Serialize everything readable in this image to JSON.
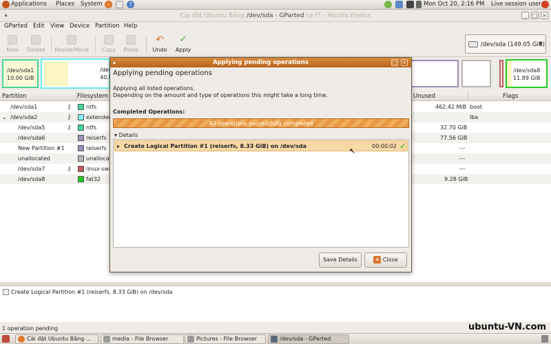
{
  "top_panel": {
    "menus": [
      "Applications",
      "Places",
      "System"
    ],
    "clock": "Mon Oct 20,  2:16 PM",
    "session": "Live session user"
  },
  "window": {
    "title_faded_left": "Cài đặt Ubuntu Bằng",
    "title": "/dev/sda - GParted",
    "title_faded_right": "ce IT - Mozilla Firefox"
  },
  "menubar": [
    "GParted",
    "Edit",
    "View",
    "Device",
    "Partition",
    "Help"
  ],
  "toolbar": {
    "new": "New",
    "delete": "Delete",
    "resize_move": "Resize/Move",
    "copy": "Copy",
    "paste": "Paste",
    "undo": "Undo",
    "apply": "Apply"
  },
  "device_selector": {
    "label": "/dev/sda  (149.05 GiB)"
  },
  "graph": {
    "sda1_name": "/dev/sda1",
    "sda1_size": "10.00 GiB",
    "sda2_name": "/dev/",
    "sda2_size": "40.0",
    "sda8_name": "/dev/sda8",
    "sda8_size": "11.89 GiB"
  },
  "table": {
    "headers": {
      "partition": "Partition",
      "filesystem": "Filesystem",
      "unused": "Unused",
      "flags": "Flags"
    },
    "rows": [
      {
        "partition": "/dev/sda1",
        "fs": "ntfs",
        "fs_color": "#42d696",
        "unused": "462.42 MiB",
        "flags": "boot"
      },
      {
        "partition": "/dev/sda2",
        "fs": "extended",
        "fs_color": "#7ef2f2",
        "unused": "",
        "flags": "lba"
      },
      {
        "partition": "/dev/sda5",
        "fs": "ntfs",
        "fs_color": "#42d696",
        "unused": "32.70 GiB",
        "flags": ""
      },
      {
        "partition": "/dev/sda6",
        "fs": "reiserfs",
        "fs_color": "#9d8fb8",
        "unused": "77.56 GiB",
        "flags": ""
      },
      {
        "partition": "New Partition #1",
        "fs": "reiserfs",
        "fs_color": "#9d8fb8",
        "unused": "---",
        "flags": ""
      },
      {
        "partition": "unallocated",
        "fs": "unallocated",
        "fs_color": "#b6b6b6",
        "unused": "---",
        "flags": ""
      },
      {
        "partition": "/dev/sda7",
        "fs": "linux-swap",
        "fs_color": "#c05a5a",
        "unused": "---",
        "flags": ""
      },
      {
        "partition": "/dev/sda8",
        "fs": "fat32",
        "fs_color": "#22cc22",
        "unused": "9.28 GiB",
        "flags": ""
      }
    ]
  },
  "log": {
    "entry": "Create Logical Partition #1 (reiserfs, 8.33 GiB) on /dev/sda"
  },
  "statusbar": {
    "text": "1 operation pending"
  },
  "watermark": "ubuntu-VN.com",
  "taskbar": [
    "Cài đặt Ubuntu Bằng ...",
    "media - File Browser",
    "Pictures - File Browser",
    "/dev/sda - GParted"
  ],
  "dialog": {
    "title": "Applying pending operations",
    "heading": "Applying pending operations",
    "desc1": "Applying all listed operations.",
    "desc2": "Depending on the amount and type of operations this might take a long time.",
    "completed_label": "Completed Operations:",
    "progress_text": "All operations successfully completed",
    "progress": 1.0,
    "details_label": "Details",
    "operation": "Create Logical Partition #1 (reiserfs, 8.33 GiB) on /dev/sda",
    "operation_time": "00:00:02",
    "save_details": "Save Details",
    "close": "Close"
  }
}
